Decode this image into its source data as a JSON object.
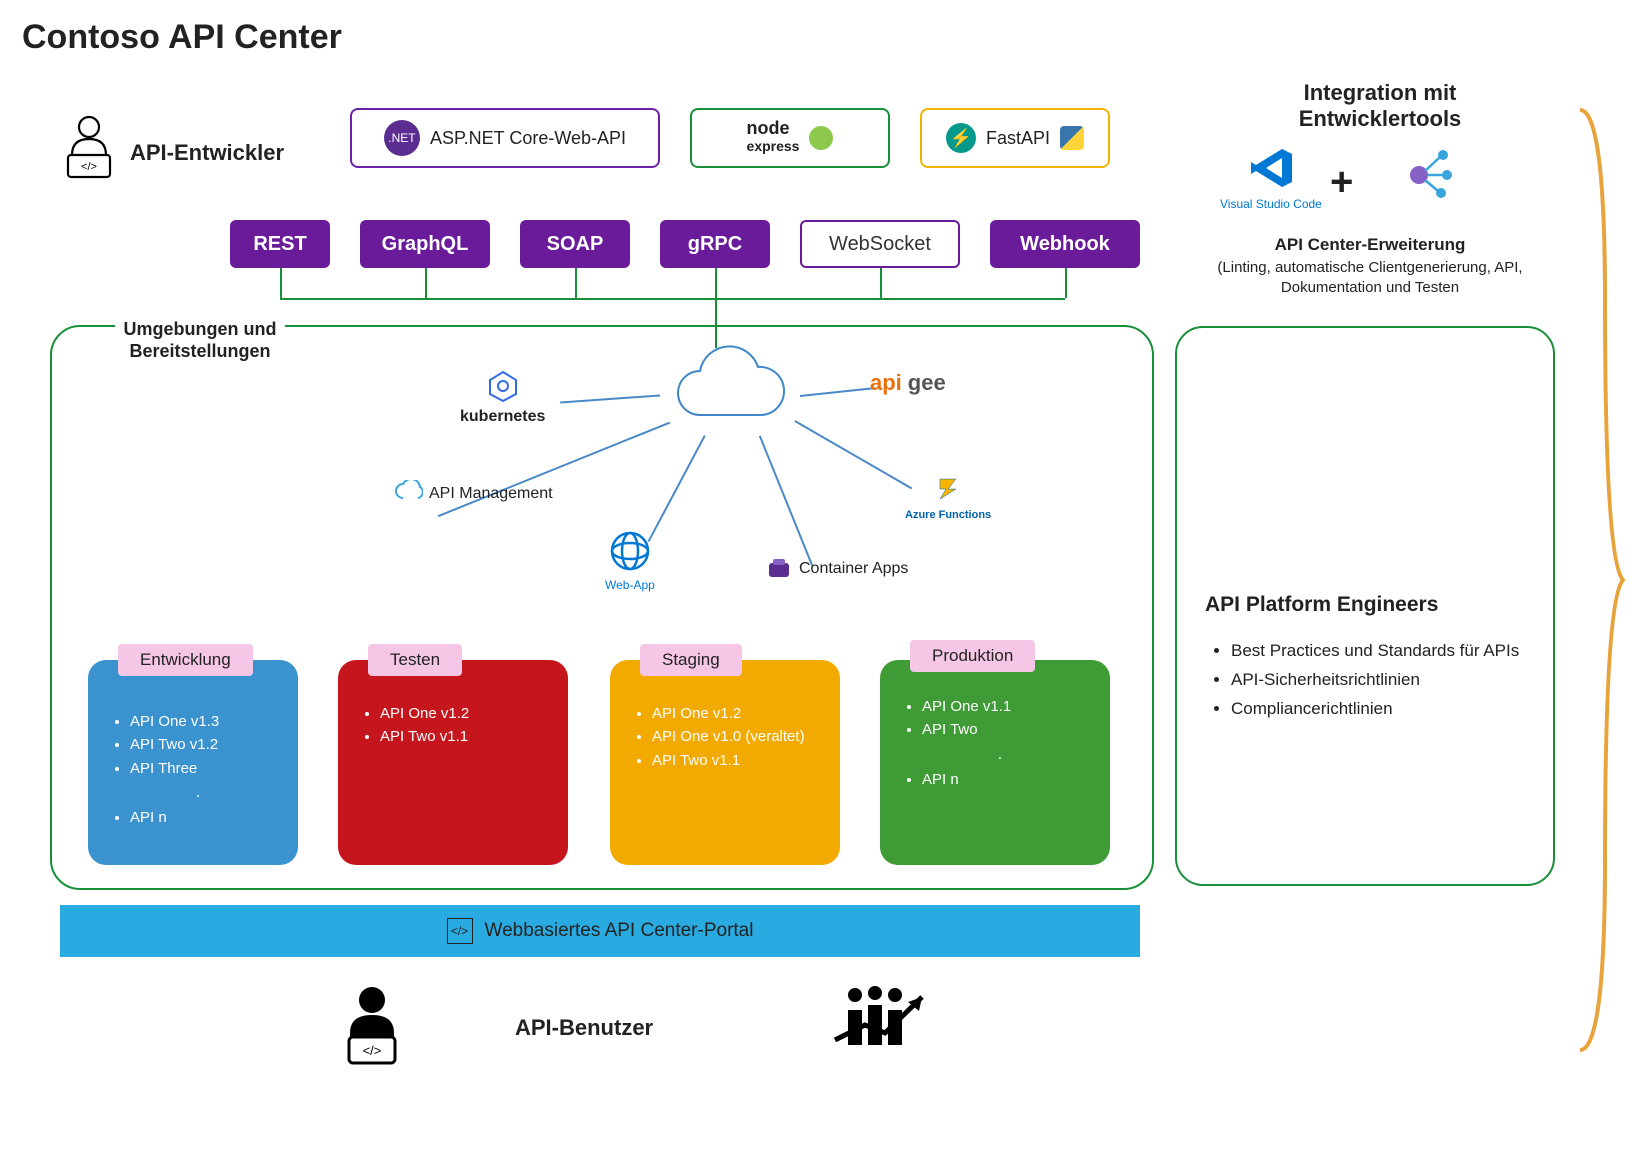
{
  "title": "Contoso API Center",
  "developer_label": "API-Entwickler",
  "frameworks": {
    "netcore": "ASP.NET Core-Web-API",
    "netcore_logo": ".NET Core",
    "node_line1": "node",
    "node_line2": "express",
    "fastapi": "FastAPI"
  },
  "protocols": {
    "rest": "REST",
    "graphql": "GraphQL",
    "soap": "SOAP",
    "grpc": "gRPC",
    "websocket": "WebSocket",
    "webhook": "Webhook"
  },
  "envbox_label": "Umgebungen und Bereitstellungen",
  "services": {
    "kubernetes": "kubernetes",
    "apigee_1": "api",
    "apigee_2": "gee",
    "apim": "API Management",
    "azfn": "Azure Functions",
    "webapp": "Web-App",
    "capps": "Container Apps"
  },
  "cards": {
    "dev": {
      "tab": "Entwicklung",
      "items": [
        "API One v1.3",
        "API Two v1.2",
        "API Three"
      ],
      "last": "API n"
    },
    "test": {
      "tab": "Testen",
      "items": [
        "API One v1.2",
        "API Two v1.1"
      ]
    },
    "stage": {
      "tab": "Staging",
      "items": [
        "API One v1.2",
        "API One v1.0 (veraltet)",
        "API Two v1.1"
      ]
    },
    "prod": {
      "tab": "Produktion",
      "items": [
        "API One v1.1",
        "API Two"
      ],
      "last": "API n"
    }
  },
  "portal": "Webbasiertes API Center-Portal",
  "user_label": "API-Benutzer",
  "right": {
    "title": "Integration mit Entwicklertools",
    "vscode": "Visual Studio Code",
    "plus": "+",
    "sub": "API Center-Erweiterung",
    "sub2": "(Linting, automatische Clientgenerierung, API, Dokumentation und Testen",
    "box_title": "API Platform Engineers",
    "box_items": [
      "Best Practices und Standards für APIs",
      "API-Sicherheitsrichtlinien",
      "Compliancerichtlinien"
    ]
  }
}
